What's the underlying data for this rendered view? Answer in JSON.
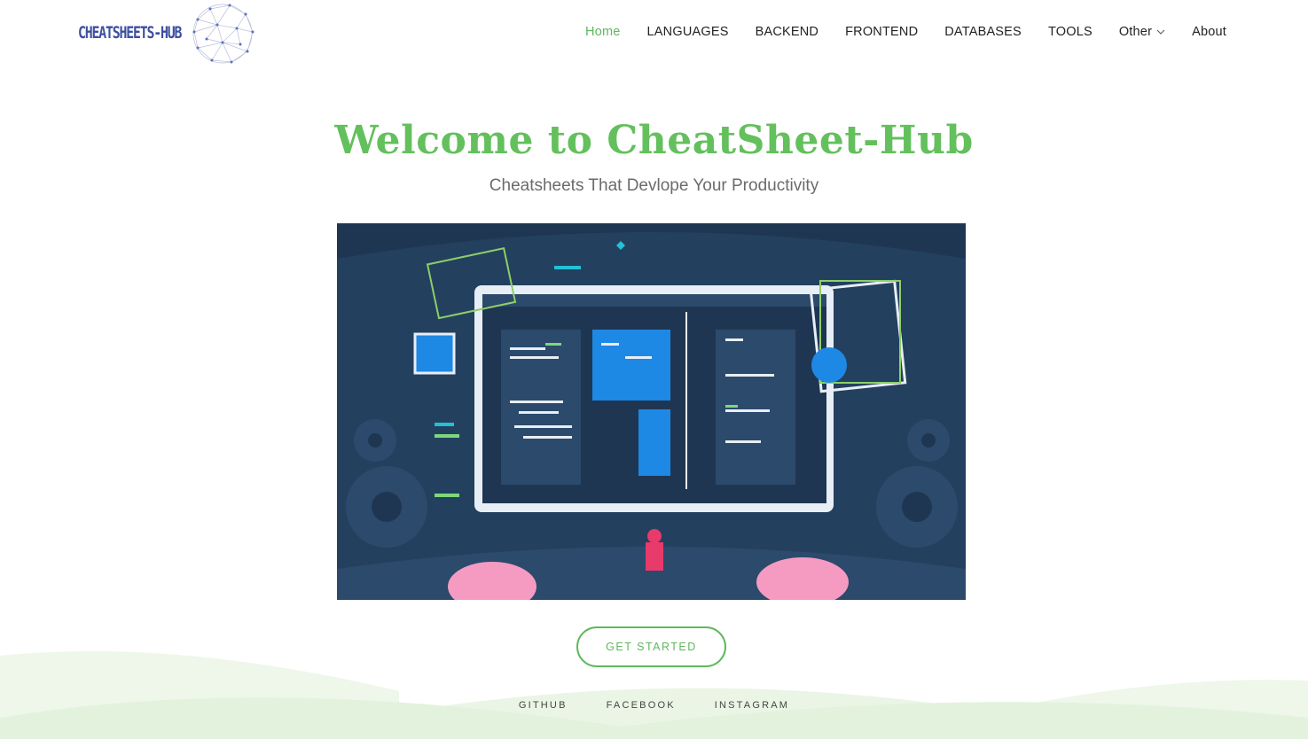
{
  "logo": {
    "text": "CHEATSHEETS-HUB"
  },
  "nav": {
    "items": [
      {
        "label": "Home",
        "active": true
      },
      {
        "label": "LANGUAGES"
      },
      {
        "label": "BACKEND"
      },
      {
        "label": "FRONTEND"
      },
      {
        "label": "DATABASES"
      },
      {
        "label": "TOOLS"
      },
      {
        "label": "Other",
        "dropdown": true
      },
      {
        "label": "About"
      }
    ]
  },
  "hero": {
    "title": "Welcome to CheatSheet-Hub",
    "subtitle": "Cheatsheets That Devlope Your Productivity",
    "cta_label": "GET STARTED"
  },
  "social": {
    "github": "GITHUB",
    "facebook": "FACEBOOK",
    "instagram": "INSTAGRAM"
  },
  "colors": {
    "accent": "#5fb85c",
    "hero_bg": "#1f3652",
    "logo": "#3d4fa0"
  }
}
